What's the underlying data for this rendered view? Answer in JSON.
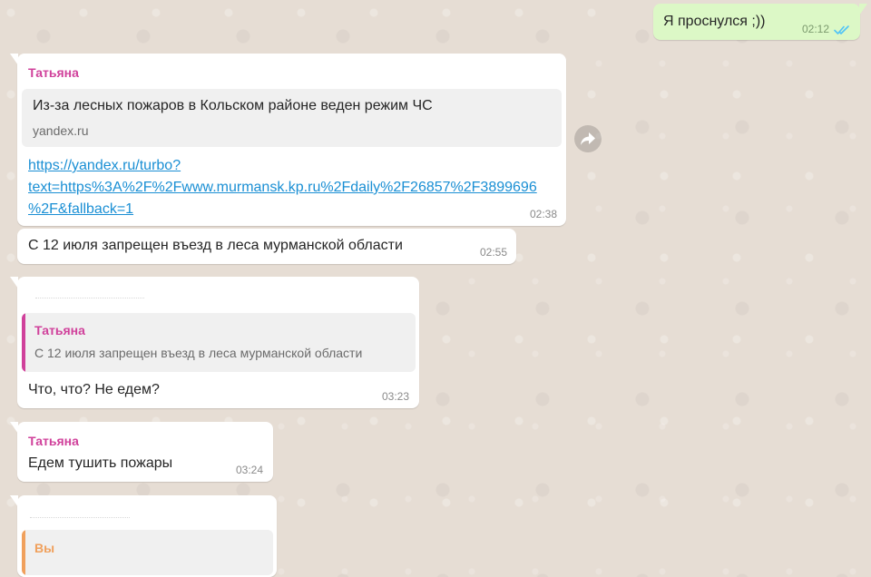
{
  "colors": {
    "chat_background": "#e6ddd4",
    "incoming_bubble": "#ffffff",
    "outgoing_bubble": "#dcf8c6",
    "sender_tatyana": "#d0419b",
    "sender_you": "#f0a05c",
    "link": "#1a8fd4",
    "read_ticks": "#4fc3f7"
  },
  "icons": {
    "read_receipt": "double-check-icon",
    "forward": "forward-arrow-icon"
  },
  "messages": {
    "m1": {
      "direction": "outgoing",
      "text": "Я проснулся ;))",
      "time": "02:12"
    },
    "m2": {
      "direction": "incoming",
      "sender": "Татьяна",
      "preview_title": "Из-за лесных пожаров в Кольском районе веден режим ЧС",
      "preview_domain": "yandex.ru",
      "link_lines": [
        "https://yandex.ru/turbo?",
        "text=https%3A%2F%2Fwww.murmansk.kp.ru%2Fdaily%2F26857%2F3899696",
        "%2F&fallback=1"
      ],
      "time": "02:38"
    },
    "m3": {
      "direction": "incoming",
      "text": "С 12 июля запрещен въезд в леса мурманской области",
      "time": "02:55"
    },
    "m4": {
      "direction": "incoming",
      "quote_sender": "Татьяна",
      "quote_text": "С 12 июля запрещен въезд в леса мурманской области",
      "text": "Что, что? Не едем?",
      "time": "03:23"
    },
    "m5": {
      "direction": "incoming",
      "sender": "Татьяна",
      "text": "Едем тушить пожары",
      "time": "03:24"
    },
    "m6": {
      "direction": "incoming",
      "quote_sender": "Вы"
    }
  }
}
